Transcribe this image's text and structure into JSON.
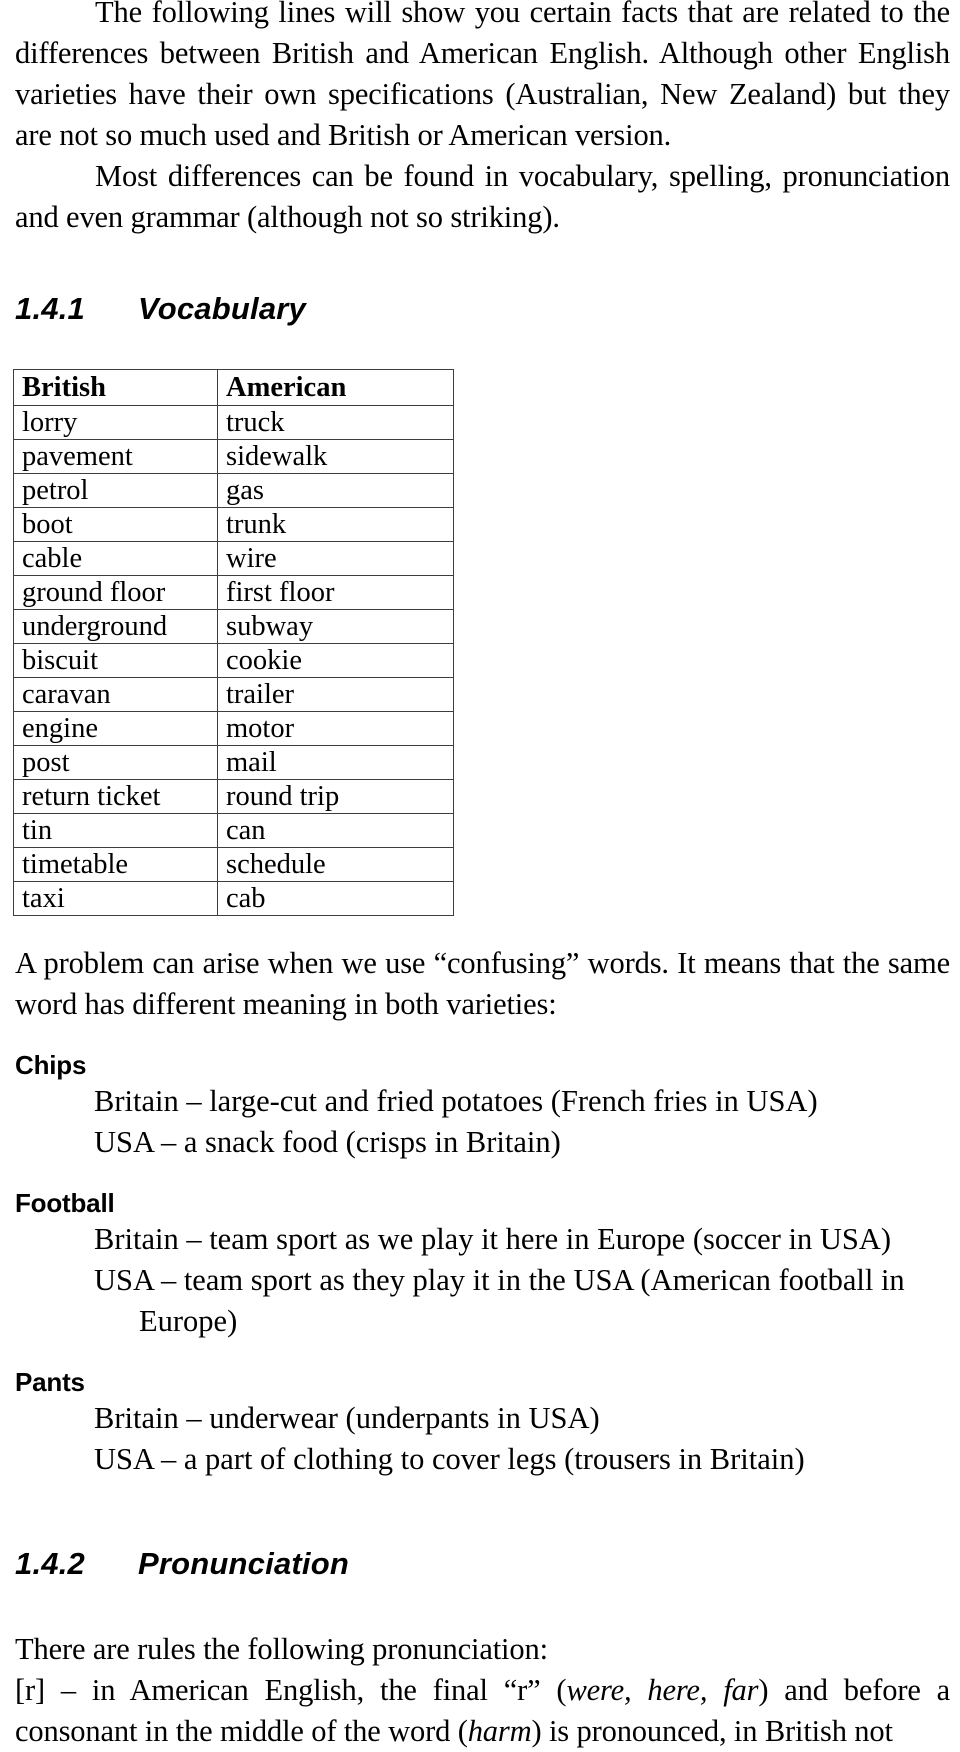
{
  "document": {
    "intro": {
      "paragraph_1": "The following lines will show you certain facts that are related to the differences between British and American English. Although other English varieties have their own specifications (Australian, New Zealand) but they are not so much used and British or American version.",
      "paragraph_2": "Most differences can be found in vocabulary, spelling, pronunciation and even grammar (although not so striking)."
    },
    "section_vocabulary": {
      "number": "1.4.1",
      "title": "Vocabulary",
      "table": {
        "headers": [
          "British",
          "American"
        ],
        "rows": [
          [
            "lorry",
            "truck"
          ],
          [
            "pavement",
            "sidewalk"
          ],
          [
            "petrol",
            "gas"
          ],
          [
            "boot",
            "trunk"
          ],
          [
            "cable",
            "wire"
          ],
          [
            "ground floor",
            "first floor"
          ],
          [
            "underground",
            "subway"
          ],
          [
            "biscuit",
            "cookie"
          ],
          [
            "caravan",
            "trailer"
          ],
          [
            "engine",
            "motor"
          ],
          [
            "post",
            "mail"
          ],
          [
            "return ticket",
            "round trip"
          ],
          [
            "tin",
            "can"
          ],
          [
            "timetable",
            "schedule"
          ],
          [
            "taxi",
            "cab"
          ]
        ]
      },
      "confusing_intro": "A problem can arise when we use “confusing” words. It means that the same word has different meaning in both varieties:",
      "entries": [
        {
          "term": "Chips",
          "britain": "Britain – large-cut and fried potatoes (French fries in USA)",
          "usa": "USA – a snack food (crisps in Britain)",
          "usa_cont": ""
        },
        {
          "term": "Football",
          "britain": "Britain – team sport as we play it here in Europe (soccer in USA)",
          "usa": "USA – team sport as they play it in the USA (American football in",
          "usa_cont": "Europe)"
        },
        {
          "term": "Pants",
          "britain": "Britain – underwear (underpants in USA)",
          "usa": "USA – a part of clothing to cover legs (trousers in Britain)",
          "usa_cont": ""
        }
      ]
    },
    "section_pronunciation": {
      "number": "1.4.2",
      "title": "Pronunciation",
      "intro": "There are rules the following pronunciation:",
      "rule": {
        "part_1": "[r] – in American English, the final “r” (",
        "italic_1": "were, here, far",
        "part_2": ") and before a consonant in the middle of the word (",
        "italic_2": "harm",
        "part_3": ") is pronounced, in British not"
      }
    }
  }
}
